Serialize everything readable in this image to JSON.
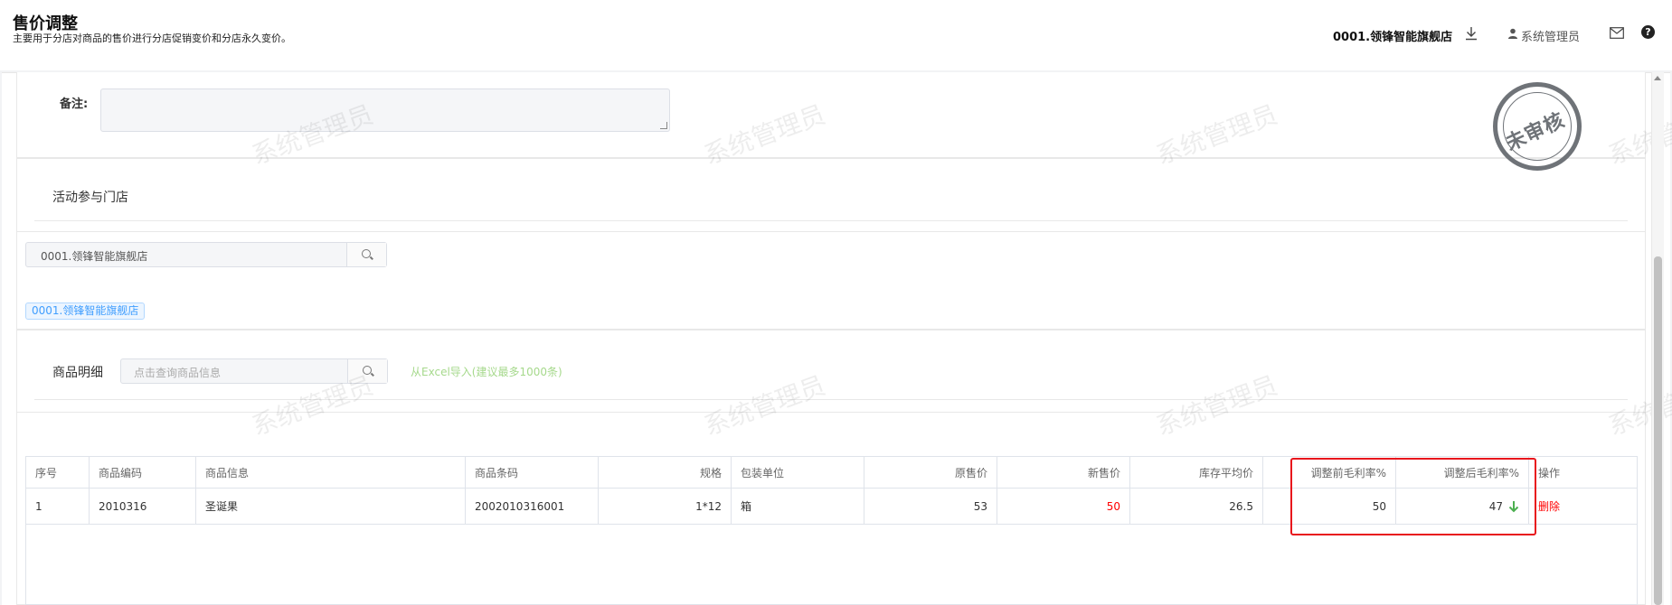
{
  "header": {
    "title": "售价调整",
    "subtitle": "主要用于分店对商品的售价进行分店促销变价和分店永久变价。",
    "store": "0001.领锋智能旗舰店",
    "user": "系统管理员",
    "help": "?"
  },
  "remark": {
    "label": "备注:",
    "value": ""
  },
  "stamp": {
    "text": "未审核"
  },
  "watermark": "系统管理员",
  "stores_section": {
    "title": "活动参与门店",
    "search_value": "0001.领锋智能旗舰店",
    "tag": "0001.领锋智能旗舰店"
  },
  "goods_section": {
    "title": "商品明细",
    "search_placeholder": "点击查询商品信息",
    "excel_link": "从Excel导入(建议最多1000条)"
  },
  "table": {
    "headers": [
      "序号",
      "商品编码",
      "商品信息",
      "商品条码",
      "规格",
      "包装单位",
      "原售价",
      "新售价",
      "库存平均价",
      "调整前毛利率%",
      "调整后毛利率%",
      "操作"
    ],
    "rows": [
      {
        "seq": "1",
        "code": "2010316",
        "info": "圣诞果",
        "barcode": "2002010316001",
        "spec": "1*12",
        "unit": "箱",
        "orig_price": "53",
        "new_price": "50",
        "avg_cost": "26.5",
        "margin_before": "50",
        "margin_after": "47",
        "action": "删除"
      }
    ]
  },
  "colors": {
    "accent_red": "#ff0000",
    "arrow_green": "#4caf50",
    "tag_blue": "#409eff",
    "link_green": "#a6d98c"
  }
}
